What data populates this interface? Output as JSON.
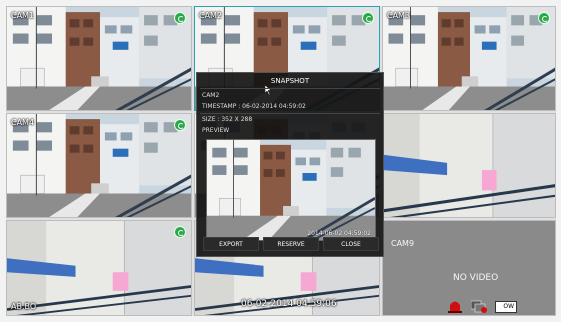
{
  "tiles": [
    {
      "id": "tile-1",
      "label": "CAM1"
    },
    {
      "id": "tile-2",
      "label": "CAM2"
    },
    {
      "id": "tile-3",
      "label": "CAM3"
    },
    {
      "id": "tile-4",
      "label": "CAM4"
    },
    {
      "id": "tile-5",
      "label": ""
    },
    {
      "id": "tile-6",
      "label": ""
    },
    {
      "id": "tile-7",
      "label": "AB.BO"
    },
    {
      "id": "tile-8",
      "label": "06-02-2014 04:59:06"
    }
  ],
  "info_panel": {
    "label": "CAM9",
    "status": "NO VIDEO",
    "badge": "OW"
  },
  "snapshot": {
    "title": "SNAPSHOT",
    "camera": "CAM2",
    "timestamp": "TIMESTAMP : 06-02-2014 04:59:02",
    "size": "SIZE : 352 X 288",
    "preview_label": "PREVIEW",
    "preview_timestamp": "2014-06-02 04:59:02",
    "buttons": {
      "export": "EXPORT",
      "reserve": "RESERVE",
      "close": "CLOSE"
    }
  },
  "colors": {
    "record_indicator": "#2aa84a",
    "dialog_bg": "#141414",
    "alarm_red": "#d01010"
  }
}
